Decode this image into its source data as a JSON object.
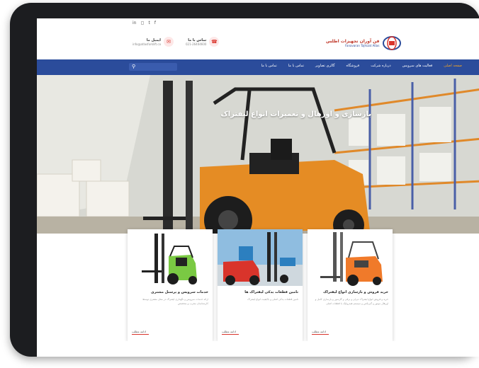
{
  "social": [
    "in",
    "◻",
    "t",
    "f"
  ],
  "header": {
    "email": {
      "label": "ایمیل ما",
      "value": "info@atlasforklift.co"
    },
    "phone": {
      "label": "تماس با ما",
      "value": "021-26404600"
    },
    "logo": {
      "title": "فن آوران تجهیزات اطلس",
      "subtitle": "Fanavaran Tajhizat Atlas"
    }
  },
  "nav": {
    "items": [
      "صفحه اصلی",
      "فعالیت های سرویس",
      "درباره شرکت",
      "فروشگاه",
      "گالری تصاویر",
      "تماس با ما",
      "تماس با ما"
    ],
    "active_index": 0
  },
  "hero": {
    "title": "بازسازی و اورهال و تعمیرات انواع لیفتراک"
  },
  "cards": [
    {
      "title": "خدمات سرویس و پرسنل مشتری",
      "desc": "ارائه خدمات سرویس و نگهداری لیفتراک در محل مشتری توسط کارشناسان مجرب و متخصص",
      "more": "ادامه مطلب"
    },
    {
      "title": "تامین قطعات یدکی لیفتراک ها",
      "desc": "تامین قطعات یدکی اصلی و باکیفیت انواع لیفتراک",
      "more": "ادامه مطلب"
    },
    {
      "title": "خرید فروش و بازسازی انواع لیفتراک",
      "desc": "خرید و فروش انواع لیفتراک دیزلی و برقی و گازسوز و بازسازی کامل و اورهال موتور و گیربکس و سیستم هیدرولیک با قطعات اصلی",
      "more": "ادامه مطلب"
    }
  ],
  "colors": {
    "nav": "#2b4c9b",
    "accent": "#d9342b",
    "forklift_orange": "#e58c24",
    "forklift_green": "#7ac943",
    "forklift_red": "#d9342b"
  }
}
